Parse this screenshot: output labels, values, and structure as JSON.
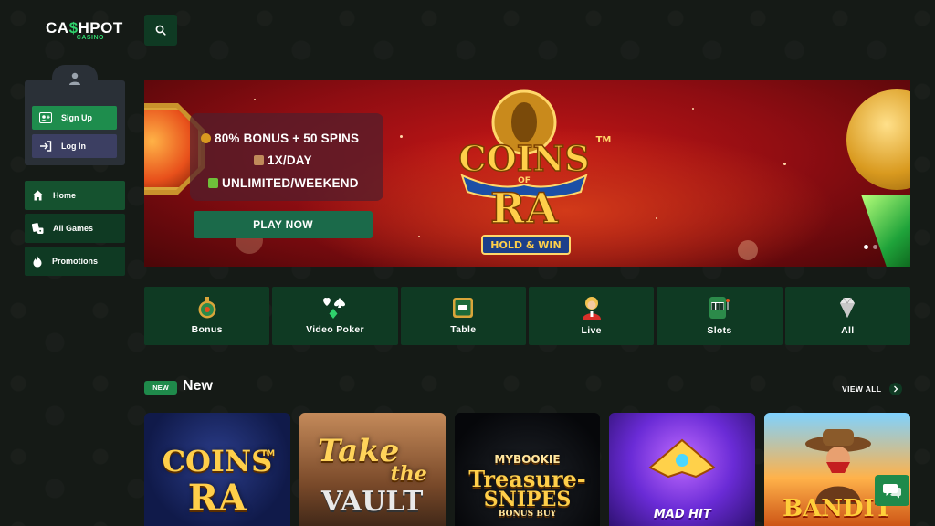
{
  "brand": {
    "logo_main_a": "CA",
    "logo_dollar": "$",
    "logo_main_b": "HPOT",
    "logo_sub": "CASINO"
  },
  "header": {
    "search_icon": "search-icon"
  },
  "account": {
    "signup_label": "Sign Up",
    "login_label": "Log In"
  },
  "sidebar": {
    "items": [
      {
        "label": "Home",
        "icon": "home-icon"
      },
      {
        "label": "All Games",
        "icon": "cards-dice-icon"
      },
      {
        "label": "Promotions",
        "icon": "fire-icon"
      }
    ]
  },
  "banner": {
    "promo_line_1": "80% BONUS + 50 SPINS",
    "promo_line_2": "1X/DAY",
    "promo_line_3": "UNLIMITED/WEEKEND",
    "play_label": "PLAY NOW",
    "game_title_top": "COINS",
    "game_title_of": "OF",
    "game_title_bottom": "RA",
    "game_tm": "TM",
    "game_tagline": "HOLD & WIN"
  },
  "categories": [
    {
      "label": "Bonus",
      "icon": "bonus-wheel-icon"
    },
    {
      "label": "Video Poker",
      "icon": "card-suits-icon"
    },
    {
      "label": "Table",
      "icon": "table-icon"
    },
    {
      "label": "Live",
      "icon": "live-dealer-icon"
    },
    {
      "label": "Slots",
      "icon": "slot-machine-icon"
    },
    {
      "label": "All",
      "icon": "diamond-icon"
    }
  ],
  "section": {
    "badge": "NEW",
    "title": "New",
    "view_all": "VIEW ALL"
  },
  "games": [
    {
      "title_a": "COINS",
      "title_b": "RA",
      "tm": "TM"
    },
    {
      "title_a": "Take",
      "title_b": "the",
      "title_c": "VAULT"
    },
    {
      "title_a": "MYBOOKIE",
      "title_b": "Treasure-",
      "title_c": "SNIPES",
      "title_d": "BONUS BUY"
    },
    {
      "title_a": "MAD HIT"
    },
    {
      "title_a": "BANDIT"
    }
  ],
  "colors": {
    "accent": "#1f8a4b",
    "nav_bg": "#0f3a23",
    "page_bg": "#151a16",
    "login_bg": "#3c3f62"
  }
}
